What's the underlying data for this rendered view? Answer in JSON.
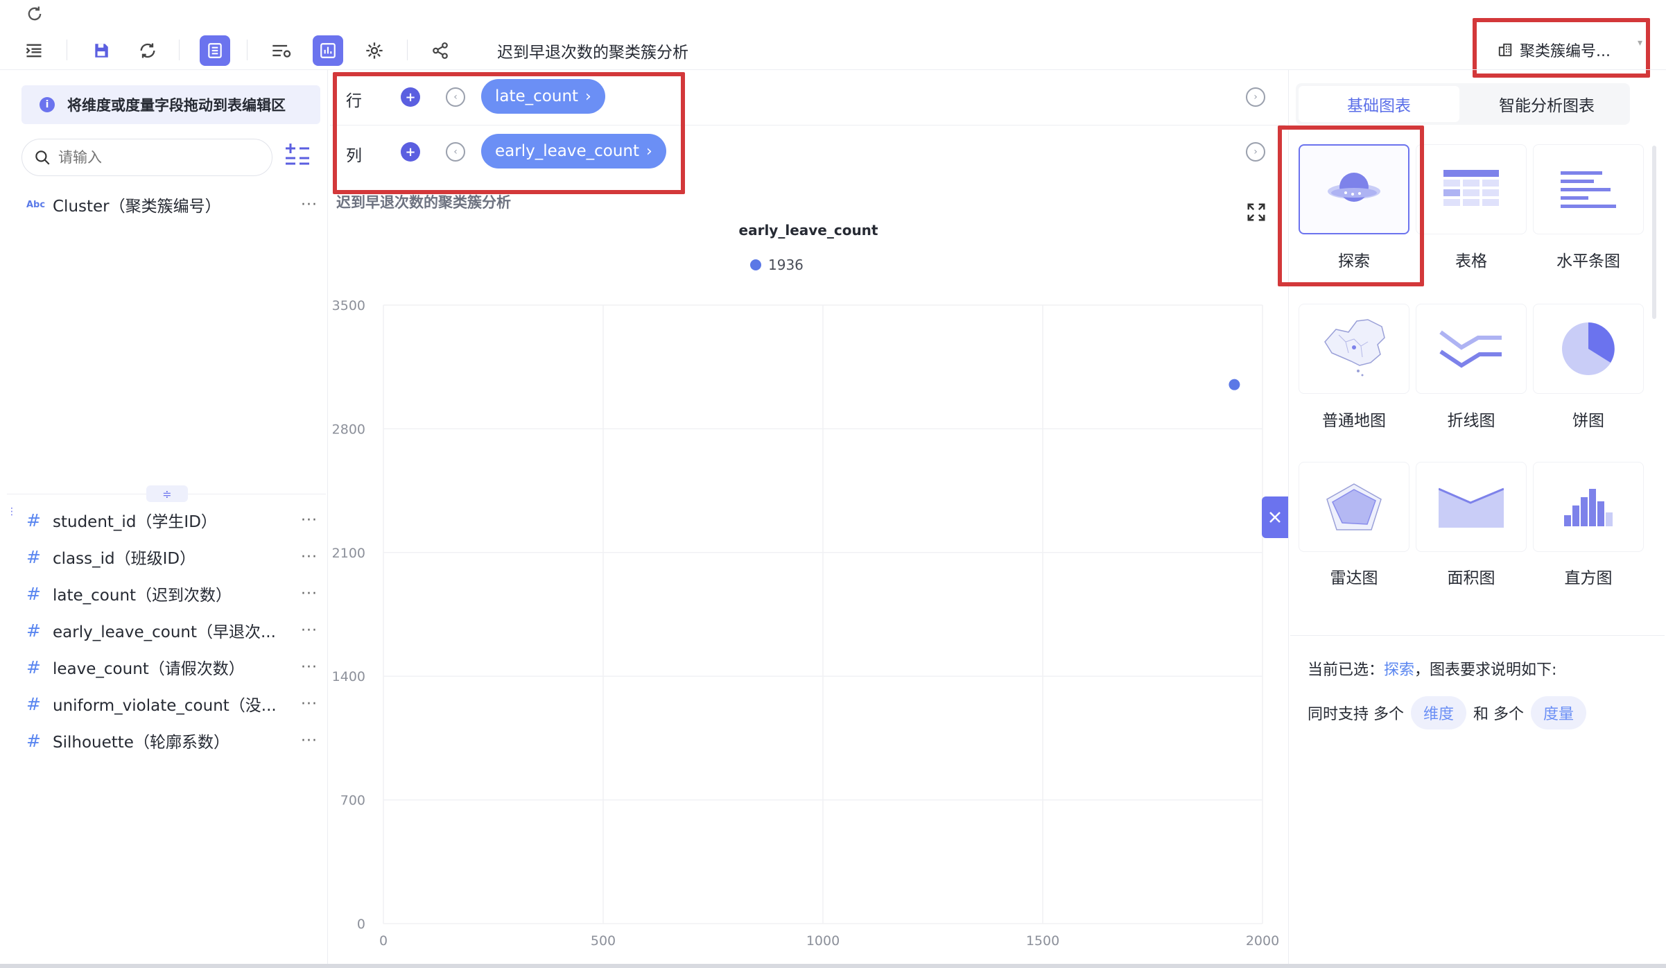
{
  "toolbar": {
    "title": "迟到早退次数的聚类簇分析",
    "dimension_select": "聚类簇编号..."
  },
  "left": {
    "tip": "将维度或度量字段拖动到表编辑区",
    "search_placeholder": "请输入",
    "dimension_fields": [
      {
        "type_badge": "Abc",
        "label": "Cluster（聚类簇编号）"
      }
    ],
    "measure_fields": [
      {
        "label": "student_id（学生ID）"
      },
      {
        "label": "class_id（班级ID）"
      },
      {
        "label": "late_count（迟到次数）"
      },
      {
        "label": "early_leave_count（早退次..."
      },
      {
        "label": "leave_count（请假次数）"
      },
      {
        "label": "uniform_violate_count（没..."
      },
      {
        "label": "Silhouette（轮廓系数）"
      }
    ],
    "more": "···"
  },
  "shelves": {
    "row_label": "行",
    "row_pill": "late_count",
    "col_label": "列",
    "col_pill": "early_leave_count"
  },
  "chart": {
    "title": "迟到早退次数的聚类簇分析"
  },
  "chart_data": {
    "type": "scatter",
    "title": "early_leave_count",
    "legend": [
      "1936"
    ],
    "legend_position": "top-center",
    "xlabel": "",
    "ylabel": "",
    "xlim": [
      0,
      2000
    ],
    "ylim": [
      0,
      3500
    ],
    "x_ticks": [
      0,
      500,
      1000,
      1500,
      2000
    ],
    "y_ticks": [
      0,
      700,
      1400,
      2100,
      2800,
      3500
    ],
    "grid": true,
    "series": [
      {
        "name": "1936",
        "color": "#5b78e6",
        "points": [
          {
            "x": 1936,
            "y": 3050
          }
        ]
      }
    ]
  },
  "right": {
    "tab_basic": "基础图表",
    "tab_smart": "智能分析图表",
    "chart_types": [
      "探索",
      "表格",
      "水平条图",
      "普通地图",
      "折线图",
      "饼图",
      "雷达图",
      "面积图",
      "直方图"
    ],
    "selected_prefix": "当前已选：",
    "selected_name": "探索",
    "selected_suffix": "，图表要求说明如下:",
    "req_prefix": "同时支持 多个",
    "req_dim": "维度",
    "req_mid": "和 多个",
    "req_measure": "度量"
  },
  "colors": {
    "accent": "#6b73ee",
    "pill": "#6b8ff5",
    "highlight_box": "#d3383a",
    "point": "#5b78e6"
  }
}
